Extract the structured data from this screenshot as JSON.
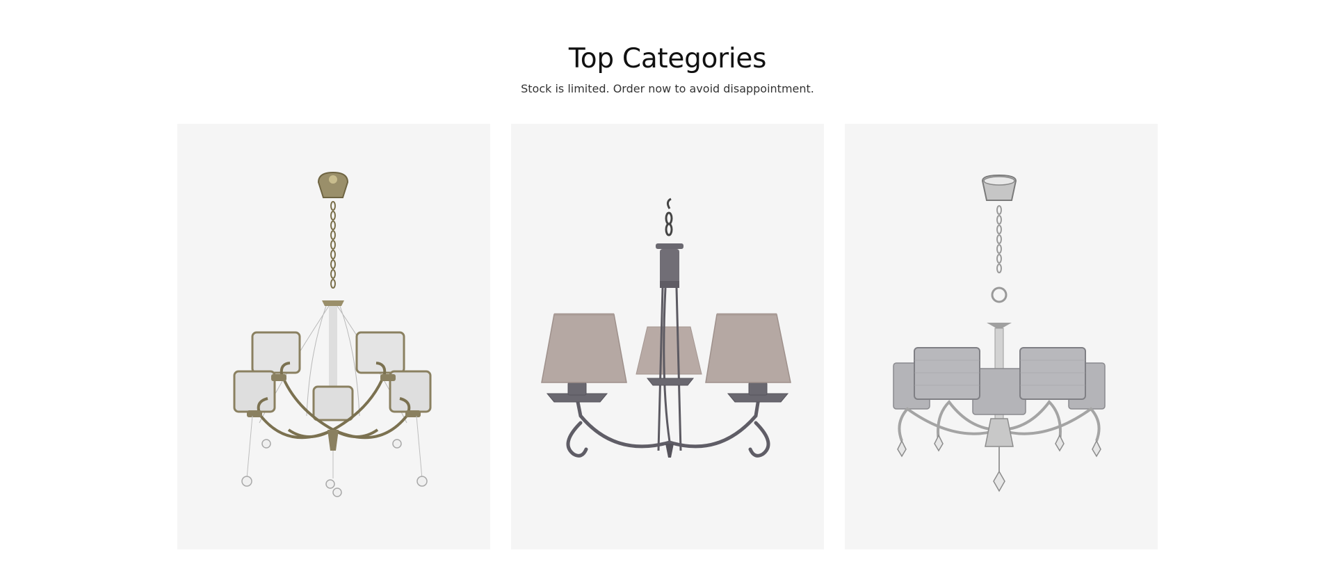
{
  "section": {
    "title": "Top Categories",
    "subtitle": "Stock is limited. Order now to avoid disappointment."
  },
  "categories": [
    {
      "product": "brass-chandelier-with-white-shades"
    },
    {
      "product": "grey-chandelier-with-taupe-shades"
    },
    {
      "product": "chrome-chandelier-with-grey-shades"
    }
  ],
  "colors": {
    "page_background": "#ffffff",
    "card_background": "#f5f5f5",
    "heading_text": "#111111",
    "subheading_text": "#333333"
  }
}
